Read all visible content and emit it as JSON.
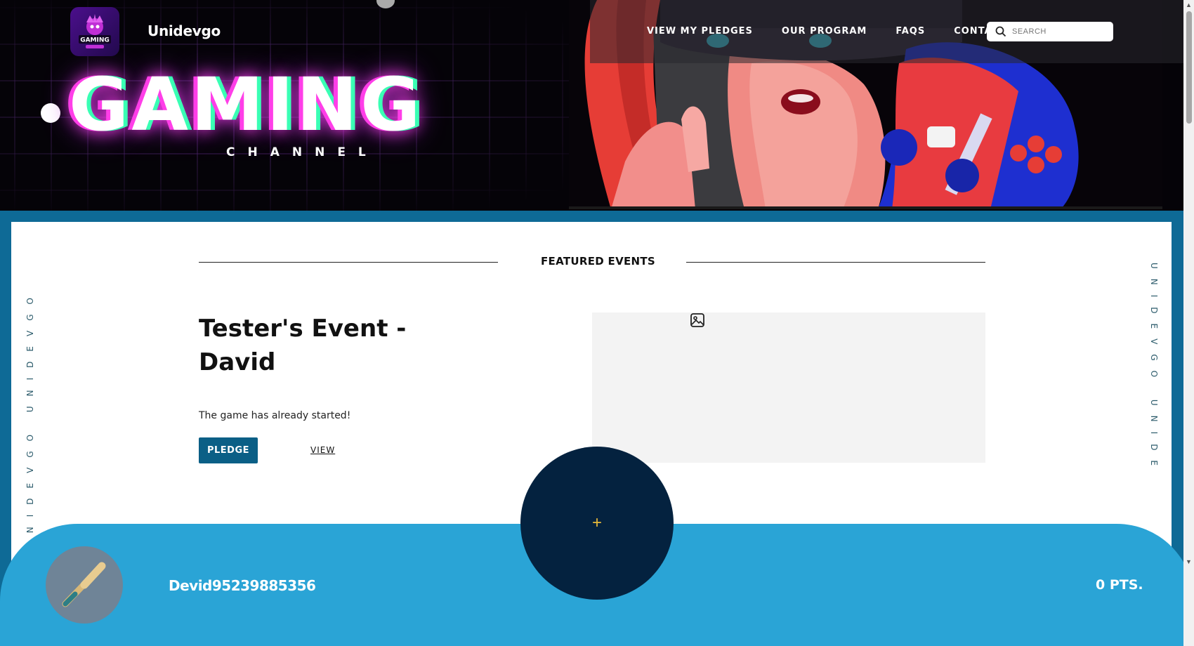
{
  "brand": {
    "name": "Unidevgo",
    "logo_text": "GAMING"
  },
  "nav": {
    "links": [
      "VIEW MY PLEDGES",
      "OUR PROGRAM",
      "FAQS",
      "CONTACT"
    ],
    "search_placeholder": "SEARCH"
  },
  "hero": {
    "title": "GAMING",
    "subtitle": "CHANNEL"
  },
  "side_text": {
    "left": "UNIDEVGO UNIDEVGO",
    "right": "UNIDEVGO UNIDE"
  },
  "featured": {
    "heading": "FEATURED EVENTS",
    "event_title": "Tester's Event - David",
    "event_description": "The game has already started!",
    "pledge_label": "PLEDGE",
    "view_label": "VIEW"
  },
  "footer": {
    "username": "Devid95239885356",
    "points": "0 PTS.",
    "fab_label": "+"
  },
  "colors": {
    "primary": "#0b5f86",
    "footer": "#2aa4d6",
    "fab": "#04223f",
    "accent": "#e6b93a"
  }
}
